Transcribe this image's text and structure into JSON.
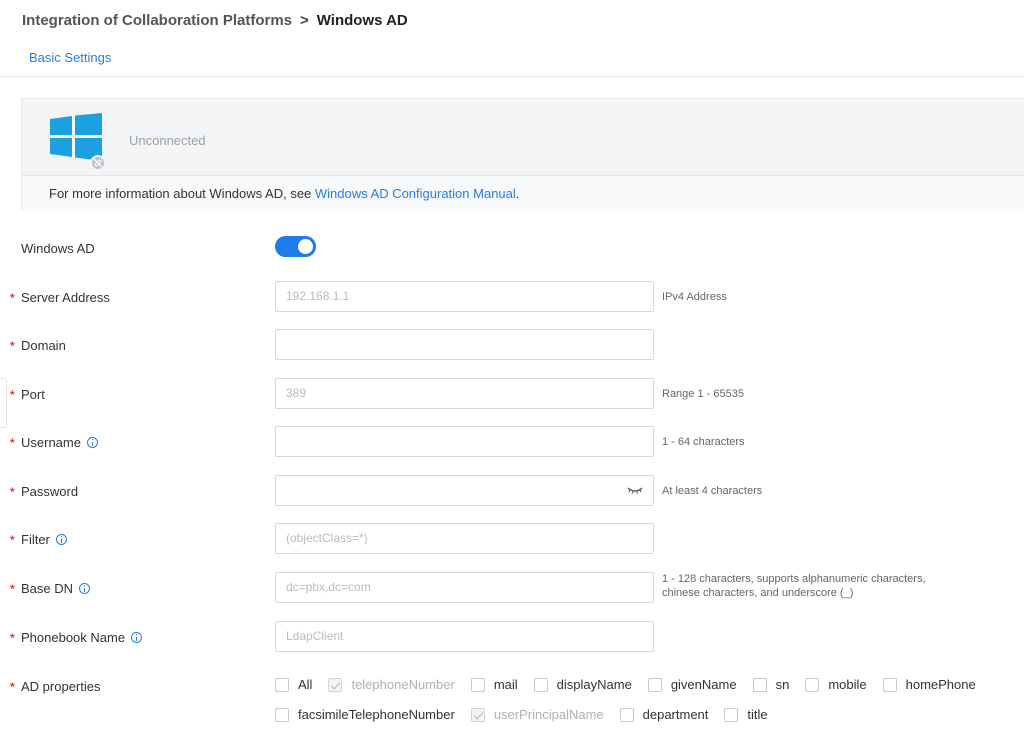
{
  "breadcrumb": {
    "parent": "Integration of Collaboration Platforms",
    "separator": ">",
    "current": "Windows AD"
  },
  "tabs": [
    {
      "label": "Basic Settings",
      "active": true
    }
  ],
  "status_card": {
    "status": "Unconnected",
    "info_prefix": "For more information about Windows AD, see ",
    "info_link": "Windows AD Configuration Manual",
    "info_suffix": "."
  },
  "form": {
    "windows_ad": {
      "label": "Windows AD",
      "enabled": true
    },
    "server_address": {
      "label": "Server Address",
      "placeholder": "192.168.1.1",
      "hint": "IPv4 Address"
    },
    "domain": {
      "label": "Domain",
      "placeholder": ""
    },
    "port": {
      "label": "Port",
      "placeholder": "389",
      "hint": "Range 1 - 65535"
    },
    "username": {
      "label": "Username",
      "placeholder": "",
      "hint": "1 - 64 characters"
    },
    "password": {
      "label": "Password",
      "placeholder": "",
      "hint": "At least 4 characters"
    },
    "filter": {
      "label": "Filter",
      "placeholder": "(objectClass=*)"
    },
    "base_dn": {
      "label": "Base DN",
      "placeholder": "dc=pbx,dc=com",
      "hint_line1": "1 - 128 characters, supports alphanumeric characters,",
      "hint_line2": "chinese characters, and underscore (_)"
    },
    "phonebook_name": {
      "label": "Phonebook Name",
      "placeholder": "LdapClient"
    },
    "ad_properties": {
      "label": "AD properties",
      "row1": [
        {
          "label": "All",
          "checked": false,
          "disabled": false
        },
        {
          "label": "telephoneNumber",
          "checked": true,
          "disabled": true
        },
        {
          "label": "mail",
          "checked": false,
          "disabled": false
        },
        {
          "label": "displayName",
          "checked": false,
          "disabled": false
        },
        {
          "label": "givenName",
          "checked": false,
          "disabled": false
        },
        {
          "label": "sn",
          "checked": false,
          "disabled": false
        },
        {
          "label": "mobile",
          "checked": false,
          "disabled": false
        },
        {
          "label": "homePhone",
          "checked": false,
          "disabled": false
        }
      ],
      "row2": [
        {
          "label": "facsimileTelephoneNumber",
          "checked": false,
          "disabled": false
        },
        {
          "label": "userPrincipalName",
          "checked": true,
          "disabled": true
        },
        {
          "label": "department",
          "checked": false,
          "disabled": false
        },
        {
          "label": "title",
          "checked": false,
          "disabled": false
        }
      ]
    }
  },
  "colors": {
    "accent": "#1e7bea",
    "link": "#2a7de1",
    "required": "#e53935",
    "windows_logo": "#1ba1e2"
  },
  "icons": {
    "logo": "windows-logo",
    "status_badge": "disconnected-link-icon",
    "info": "info-circle-icon",
    "password_toggle": "eye-closed-icon"
  }
}
